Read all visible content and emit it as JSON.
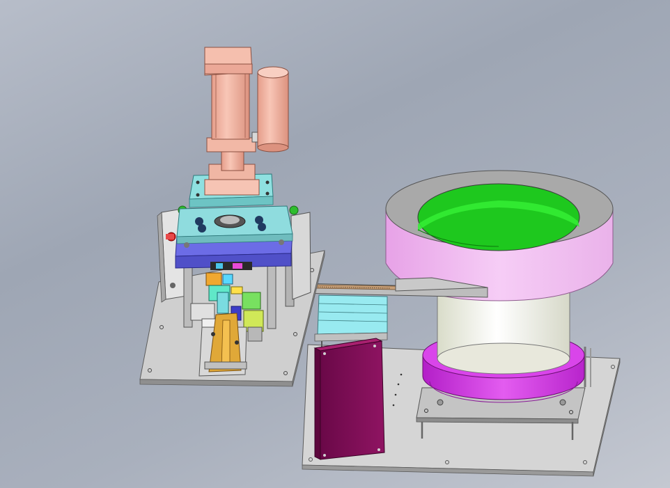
{
  "scene": {
    "background": "#a7aebb",
    "colors": {
      "cylinder": "#f2b8a6",
      "top_plate": "#8fe0e0",
      "press_plate": "#7070e0",
      "bowl_interior": "#22d822",
      "bowl_rim": "#a8a8a8",
      "bowl_body": "#f0b8f0",
      "bowl_base": "#cc33dd",
      "controller_box": "#800a55",
      "base_plate": "#d2d2d2",
      "fixture": "#e0a838",
      "feed_track": "#c8a078"
    }
  }
}
